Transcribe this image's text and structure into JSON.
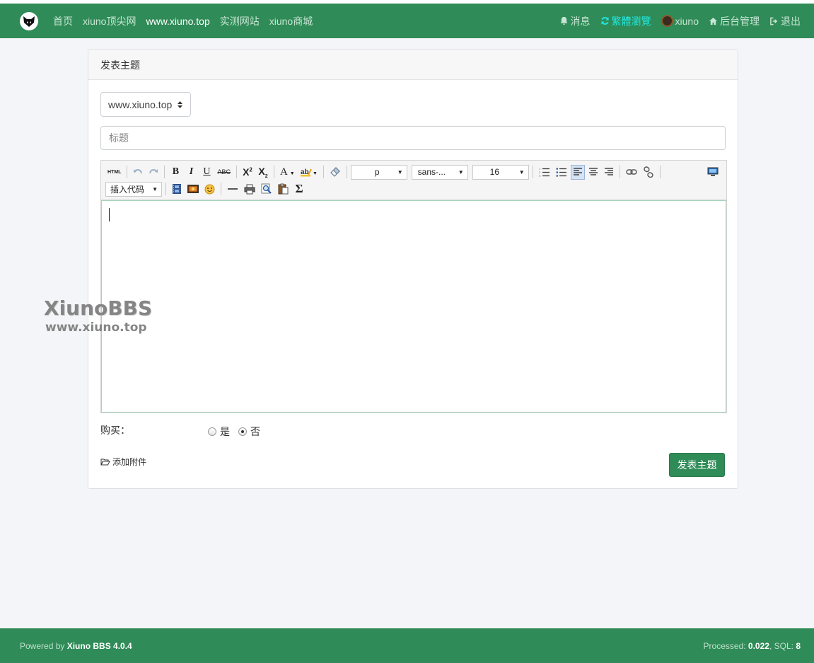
{
  "nav": {
    "links": [
      "首页",
      "xiuno顶尖网",
      "www.xiuno.top",
      "实测网站",
      "xiuno商城"
    ],
    "active_index": 2,
    "messages": "消息",
    "traditional": "繁體瀏覽",
    "username": "xiuno",
    "admin": "后台管理",
    "logout": "退出"
  },
  "card": {
    "header": "发表主题",
    "forum_select": "www.xiuno.top",
    "title_placeholder": "标题"
  },
  "editor": {
    "format_select": "p",
    "font_select": "sans-...",
    "size_select": "16",
    "insert_code": "插入代码",
    "html_label": "HTML"
  },
  "buy": {
    "label": "购买：",
    "yes": "是",
    "no": "否",
    "selected": "否"
  },
  "attach_label": "添加附件",
  "submit_label": "发表主题",
  "watermark": {
    "line1": "XiunoBBS",
    "line2": "www.xiuno.top"
  },
  "footer": {
    "powered_prefix": "Powered by ",
    "powered_name": "Xiuno BBS 4.0.4",
    "processed_prefix": "Processed: ",
    "processed_value": "0.022",
    "sql_prefix": ", SQL: ",
    "sql_value": "8"
  },
  "colors": {
    "brand": "#2f8b57",
    "nav_link": "#c7e6d4",
    "highlight": "#22e6e0"
  }
}
